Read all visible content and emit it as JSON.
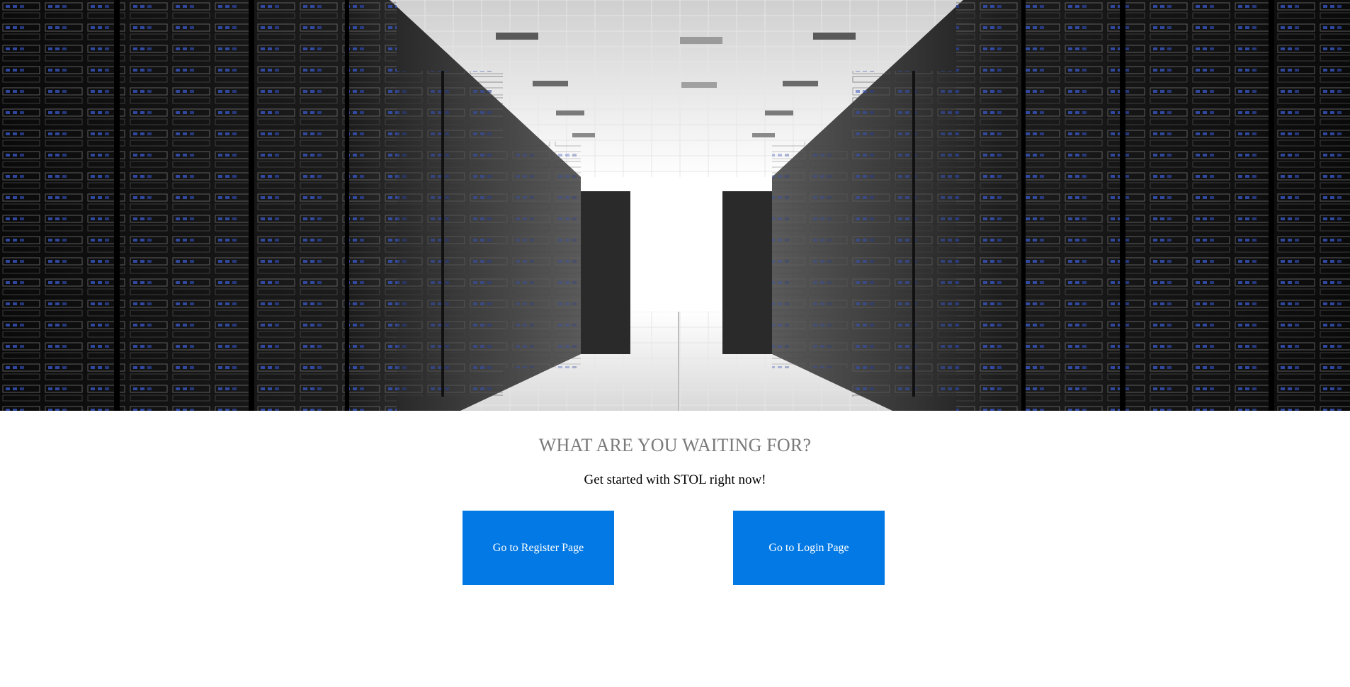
{
  "hero": {
    "image": "server-room-corridor-image"
  },
  "cta": {
    "title": "WHAT ARE YOU WAITING FOR?",
    "subtitle": "Get started with STOL right now!",
    "register_label": "Go to Register Page",
    "login_label": "Go to Login Page"
  },
  "colors": {
    "button_bg": "#0279e4",
    "button_text": "#ffffff",
    "title_text": "#7a7a7a",
    "subtitle_text": "#000000",
    "page_bg": "#ffffff"
  }
}
